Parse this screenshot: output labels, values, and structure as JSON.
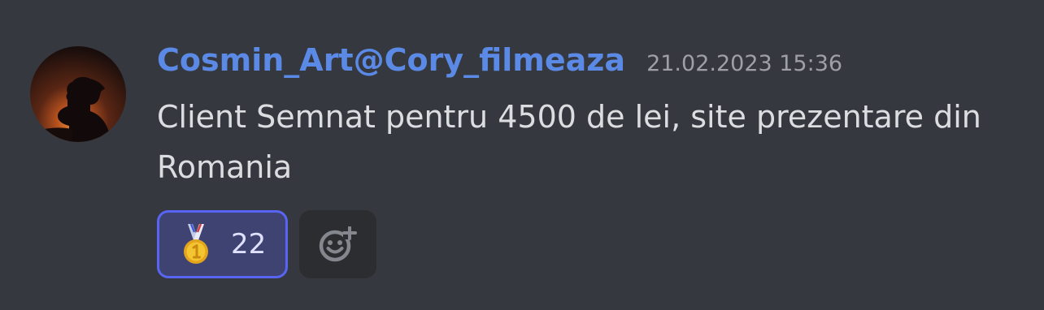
{
  "message": {
    "author": "Cosmin_Art@Cory_filmeaza",
    "timestamp": "21.02.2023 15:36",
    "content": "Client Semnat pentru 4500 de lei, site prezentare din Romania"
  },
  "reactions": [
    {
      "emoji": "first-place-medal",
      "count": "22",
      "active": true
    }
  ],
  "icons": {
    "add_reaction": "smiley-plus-icon"
  },
  "colors": {
    "background": "#36383f",
    "username": "#5b8ae6",
    "timestamp": "#9ea0a6",
    "text": "#dcdde1",
    "reaction_active_border": "#5865f2",
    "reaction_active_bg": "#3f4372",
    "add_reaction_bg": "#2b2d31"
  }
}
